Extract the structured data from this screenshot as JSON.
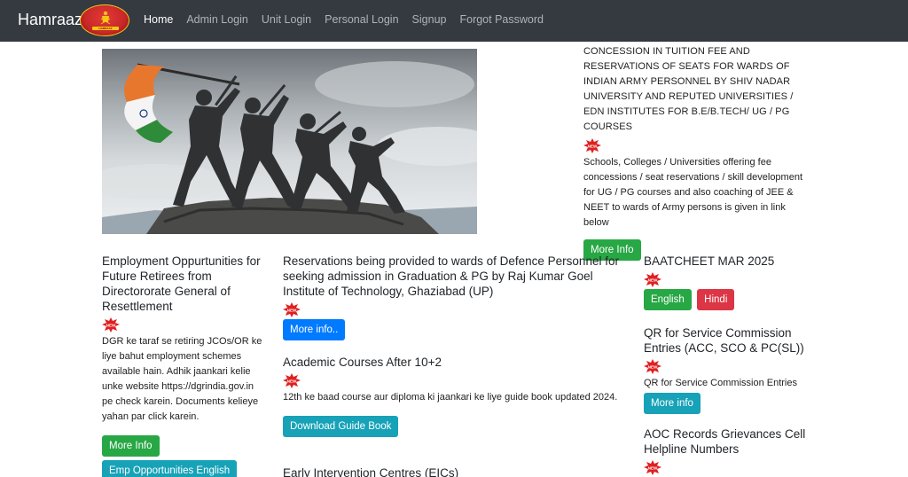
{
  "navbar": {
    "brand": "Hamraaz",
    "logo_text": "HAMRAAZ",
    "links": [
      {
        "label": "Home",
        "active": true
      },
      {
        "label": "Admin Login",
        "active": false
      },
      {
        "label": "Unit Login",
        "active": false
      },
      {
        "label": "Personal Login",
        "active": false
      },
      {
        "label": "Signup",
        "active": false
      },
      {
        "label": "Forgot Password",
        "active": false
      }
    ]
  },
  "badge_text": "NEW",
  "concession": {
    "title": "CONCESSION IN TUITION FEE AND RESERVATIONS OF SEATS FOR WARDS OF INDIAN ARMY PERSONNEL BY SHIV NADAR UNIVERSITY AND REPUTED UNIVERSITIES / EDN INSTITUTES FOR B.E/B.TECH/ UG / PG COURSES",
    "text": "Schools, Colleges / Universities offering fee concessions / seat reservations / skill development for UG / PG courses and also coaching of JEE & NEET to wards of Army persons is given in link below",
    "button": "More Info"
  },
  "employment": {
    "title": "Employment Oppurtunities for Future Retirees from Directororate General of Resettlement",
    "text": "DGR ke taraf se retiring JCOs/OR ke liye bahut employment schemes available hain. Adhik jaankari kelie unke website https://dgrindia.gov.in pe check karein. Documents kelieye yahan par click karein.",
    "button_info": "More Info",
    "button_english": "Emp Opportunities English"
  },
  "reservations": {
    "title": "Reservations being provided to wards of Defence Personnel for seeking admission in Graduation & PG by Raj Kumar Goel Institute of Technology, Ghaziabad (UP)",
    "button": "More info.."
  },
  "academic": {
    "title": "Academic Courses After 10+2",
    "text": "12th ke baad course aur diploma ki jaankari ke liye guide book updated 2024.",
    "button": "Download Guide Book"
  },
  "early": {
    "title": "Early Intervention Centres (EICs)"
  },
  "baatcheet": {
    "title": "BAATCHEET MAR 2025",
    "button_english": "English",
    "button_hindi": "Hindi"
  },
  "qr": {
    "title": "QR for Service Commission Entries (ACC, SCO & PC(SL))",
    "text": "QR for Service Commission Entries",
    "button": "More info"
  },
  "aoc": {
    "title": "AOC Records Grievances Cell Helpline Numbers"
  },
  "colors": {
    "navbar": "#343a40",
    "green": "#28a745",
    "blue": "#007bff",
    "teal": "#17a2b8",
    "red": "#dc3545"
  }
}
